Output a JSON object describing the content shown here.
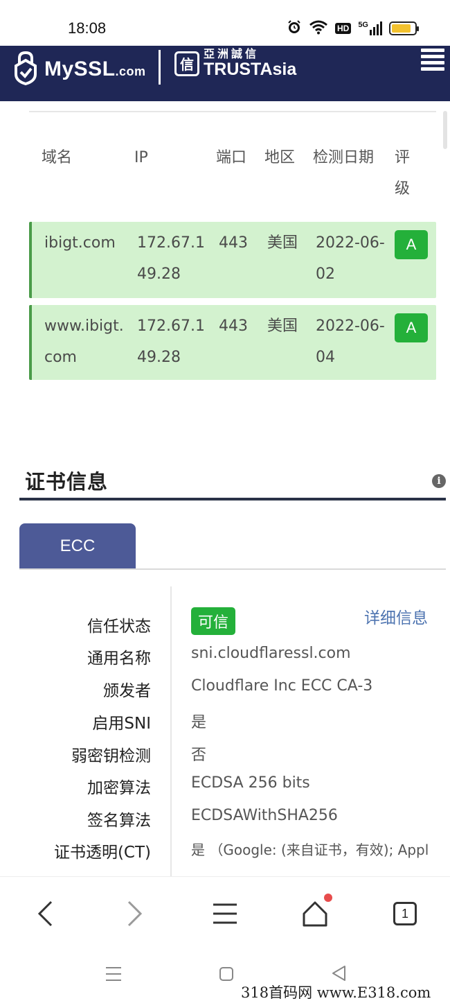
{
  "status_bar": {
    "time": "18:08",
    "icons": [
      "alarm-icon",
      "wifi-icon",
      "hd-icon",
      "5g-signal-icon",
      "battery-icon"
    ],
    "hd_label": "HD",
    "network_label": "5G",
    "battery_level": 0.85
  },
  "header": {
    "brand_main": "MySSL",
    "brand_suffix": ".com",
    "partner_cn": "亞洲誠信",
    "partner_en": "TRUSTAsia",
    "partner_mark": "信",
    "colors": {
      "background": "#1f2756"
    }
  },
  "results": {
    "headers": [
      "域名",
      "IP",
      "端口",
      "地区",
      "检测日期",
      "评级"
    ],
    "rows": [
      {
        "domain": "ibigt.com",
        "ip": "172.67.149.28",
        "port": "443",
        "region": "美国",
        "date": "2022-06-02",
        "grade": "A"
      },
      {
        "domain": "www.ibigt.com",
        "ip": "172.67.149.28",
        "port": "443",
        "region": "美国",
        "date": "2022-06-04",
        "grade": "A"
      }
    ],
    "colors": {
      "row_background": "#d3f2cf",
      "row_accent": "#4a9b49",
      "grade_badge": "#24b03a"
    }
  },
  "cert": {
    "section_title": "证书信息",
    "info_icon_glyph": "i",
    "tab_label": "ECC",
    "detail_link": "详细信息",
    "trust_status": "可信",
    "fields": [
      {
        "label": "信任状态",
        "value": ""
      },
      {
        "label": "通用名称",
        "value": "sni.cloudflaressl.com"
      },
      {
        "label": "颁发者",
        "value": "Cloudflare Inc ECC CA-3"
      },
      {
        "label": "启用SNI",
        "value": "是"
      },
      {
        "label": "弱密钥检测",
        "value": "否"
      },
      {
        "label": "加密算法",
        "value": "ECDSA 256 bits"
      },
      {
        "label": "签名算法",
        "value": "ECDSAWithSHA256"
      },
      {
        "label": "证书透明(CT)",
        "value": "是 （Google: (来自证书，有效); Appl"
      }
    ],
    "colors": {
      "tab_background": "#4d5a97",
      "trusted_badge": "#24b03a",
      "link": "#4e74b0"
    }
  },
  "browser_nav": {
    "buttons": [
      "back-icon",
      "forward-icon",
      "menu-icon",
      "home-icon",
      "tabs-icon"
    ],
    "tabs_count": "1"
  },
  "system_nav": {
    "buttons": [
      "recent-apps-icon",
      "home-square-icon",
      "back-triangle-icon"
    ]
  },
  "watermark": "318首码网  www.E318.com"
}
